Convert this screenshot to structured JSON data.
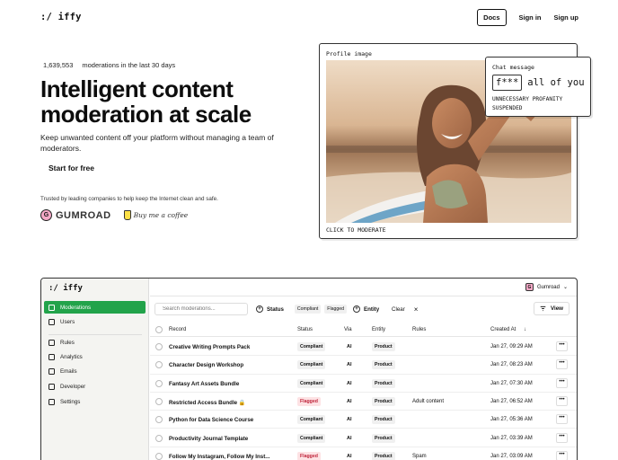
{
  "brand": {
    "logo": ":/ iffy"
  },
  "nav": {
    "docs": "Docs",
    "sign_in": "Sign in",
    "sign_up": "Sign up"
  },
  "hero": {
    "stat_number": "1,639,553",
    "stat_text": "moderations in the last 30 days",
    "headline": "Intelligent content moderation at scale",
    "subhead": "Keep unwanted content off your platform without managing a team of moderators.",
    "cta": "Start for free",
    "trusted": "Trusted by leading companies to help keep the Internet clean and safe.",
    "logo_gumroad": "GUMROAD",
    "logo_gumroad_mark": "G",
    "logo_bmc": "Buy me a coffee"
  },
  "profile_card": {
    "label": "Profile image",
    "footer": "CLICK TO MODERATE"
  },
  "chat_card": {
    "label": "Chat message",
    "redacted": "f***",
    "rest": "all of you",
    "reason_1": "UNNECESSARY PROFANITY",
    "reason_2": "SUSPENDED"
  },
  "dashboard": {
    "logo": ":/ iffy",
    "sidebar": [
      {
        "label": "Moderations",
        "active": true
      },
      {
        "label": "Users",
        "active": false
      },
      {
        "label": "Rules",
        "active": false
      },
      {
        "label": "Analytics",
        "active": false
      },
      {
        "label": "Emails",
        "active": false
      },
      {
        "label": "Developer",
        "active": false
      },
      {
        "label": "Settings",
        "active": false
      }
    ],
    "account": {
      "mark": "G",
      "name": "Gumroad",
      "caret": "⌄"
    },
    "search_placeholder": "Search moderations...",
    "filters": {
      "status_label": "Status",
      "status_pill_1": "Compliant",
      "status_pill_2": "Flagged",
      "entity_label": "Entity",
      "clear": "Clear",
      "clear_x": "×"
    },
    "view_label": "View",
    "columns": {
      "record": "Record",
      "status": "Status",
      "via": "Via",
      "entity": "Entity",
      "rules": "Rules",
      "created_at": "Created At",
      "sort": "↓"
    },
    "rows": [
      {
        "record": "Creative Writing Prompts Pack",
        "status": "Compliant",
        "via": "AI",
        "entity": "Product",
        "rules": "",
        "created": "Jan 27, 09:29 AM"
      },
      {
        "record": "Character Design Workshop",
        "status": "Compliant",
        "via": "AI",
        "entity": "Product",
        "rules": "",
        "created": "Jan 27, 08:23 AM"
      },
      {
        "record": "Fantasy Art Assets Bundle",
        "status": "Compliant",
        "via": "AI",
        "entity": "Product",
        "rules": "",
        "created": "Jan 27, 07:30 AM"
      },
      {
        "record": "Restricted Access Bundle 🔒",
        "status": "Flagged",
        "via": "AI",
        "entity": "Product",
        "rules": "Adult content",
        "created": "Jan 27, 06:52 AM"
      },
      {
        "record": "Python for Data Science Course",
        "status": "Compliant",
        "via": "AI",
        "entity": "Product",
        "rules": "",
        "created": "Jan 27, 05:36 AM"
      },
      {
        "record": "Productivity Journal Template",
        "status": "Compliant",
        "via": "AI",
        "entity": "Product",
        "rules": "",
        "created": "Jan 27, 03:39 AM"
      },
      {
        "record": "Follow My Instagram, Follow My Inst...",
        "status": "Flagged",
        "via": "AI",
        "entity": "Product",
        "rules": "Spam",
        "created": "Jan 27, 03:09 AM"
      }
    ],
    "more_glyph": "•••"
  }
}
